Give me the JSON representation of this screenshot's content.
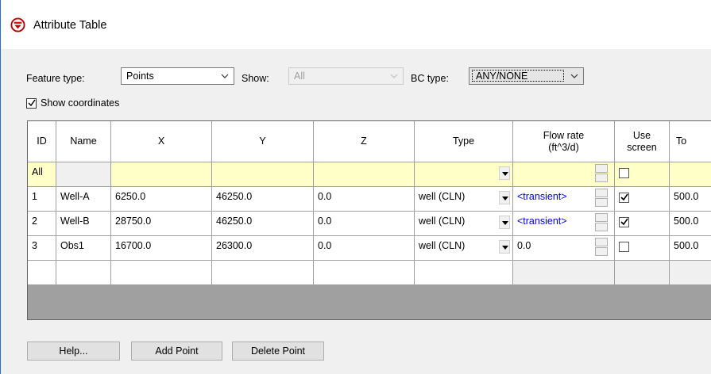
{
  "window": {
    "title": "Attribute Table"
  },
  "toolbar": {
    "feature_type_label": "Feature type:",
    "feature_type_value": "Points",
    "show_label": "Show:",
    "show_value": "All",
    "bc_type_label": "BC type:",
    "bc_type_value": "ANY/NONE",
    "show_coordinates_label": "Show coordinates",
    "show_coordinates_checked": true
  },
  "table": {
    "headers": {
      "id": "ID",
      "name": "Name",
      "x": "X",
      "y": "Y",
      "z": "Z",
      "type": "Type",
      "flow_rate_1": "Flow rate",
      "flow_rate_2": "(ft^3/d)",
      "use_screen_1": "Use",
      "use_screen_2": "screen",
      "top": "To"
    },
    "all_row": {
      "id": "All",
      "use_screen_checked": false
    },
    "rows": [
      {
        "id": "1",
        "name": "Well-A",
        "x": "6250.0",
        "y": "46250.0",
        "z": "0.0",
        "type": "well (CLN)",
        "flow_rate": "<transient>",
        "use_screen": true,
        "top": "500.0"
      },
      {
        "id": "2",
        "name": "Well-B",
        "x": "28750.0",
        "y": "46250.0",
        "z": "0.0",
        "type": "well (CLN)",
        "flow_rate": "<transient>",
        "use_screen": true,
        "top": "500.0"
      },
      {
        "id": "3",
        "name": "Obs1",
        "x": "16700.0",
        "y": "26300.0",
        "z": "0.0",
        "type": "well (CLN)",
        "flow_rate": "0.0",
        "use_screen": false,
        "top": "500.0"
      }
    ]
  },
  "buttons": {
    "help": "Help...",
    "add_point": "Add Point",
    "delete_point": "Delete Point"
  }
}
